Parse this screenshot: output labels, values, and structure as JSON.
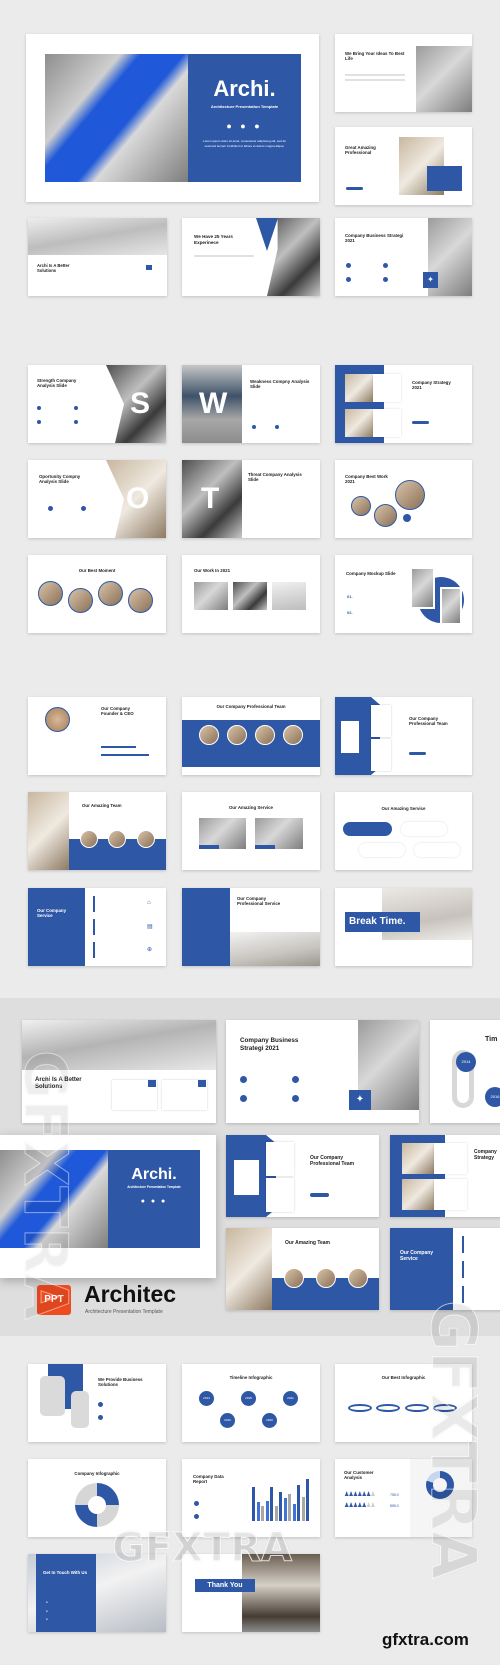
{
  "brand_color": "#2e58a6",
  "accent_color": "#ef4b21",
  "hero": {
    "title": "Archi.",
    "subtitle": "Architecture Presentation Template",
    "body": "Lorem ipsum dolor sit amet, consectetur adipiscing elit, sed do eiusmod tempor incididunt ut labore et dolore magna aliqua."
  },
  "slides_group1": [
    {
      "title": "We Bring Your Ideas To Best Life"
    },
    {
      "title": "Great Amazing Professional"
    },
    {
      "title": "Archi Is A Better Solutions"
    },
    {
      "title": "We Have 25 Years Experinece"
    },
    {
      "title": "Company Business Strategi 2021"
    }
  ],
  "slides_group2": [
    {
      "title": "Strength Company Analysis Slide",
      "letter": "S"
    },
    {
      "title": "Weakness Compny Analysis Slide",
      "letter": "W"
    },
    {
      "title": "Company Strategy 2021"
    },
    {
      "title": "Oportunity Compny Analysis Slide",
      "letter": "O"
    },
    {
      "title": "Threat Company Analysis Slide",
      "letter": "T"
    },
    {
      "title": "Company Best Work 2021"
    },
    {
      "title": "Our Best Moment"
    },
    {
      "title": "Our Work In 2021"
    },
    {
      "title": "Company Mockup Slide",
      "items": [
        "01.",
        "02."
      ]
    }
  ],
  "slides_group3": [
    {
      "title": "Our Company Founder & CEO"
    },
    {
      "title": "Our Company Professional Team"
    },
    {
      "title": "Our Company Professional Team"
    },
    {
      "title": "Our Amazing Team"
    },
    {
      "title": "Our Amazing Service"
    },
    {
      "title": "Our Amazing Service"
    },
    {
      "title": "Our Company Service"
    },
    {
      "title": "Our Company Professional Service"
    },
    {
      "title": "Break Time."
    }
  ],
  "showcase": {
    "s1": "Archi Is A Better Solutions",
    "s2": "Company Business Strategi 2021",
    "s3": "Tim",
    "timeline_years": [
      "2014",
      "2016"
    ],
    "hero_title": "Archi.",
    "hero_subtitle": "Architecture Presentation Template",
    "s4": "Our Company Professional Team",
    "s5": "Company Strategy",
    "s6": "Our Amazing Team",
    "s7": "Our Company Service"
  },
  "product": {
    "badge": "PPT",
    "name": "Architec",
    "tagline": "Architecture Presentation Template"
  },
  "slides_group4": [
    {
      "title": "We Provide Business Solutions"
    },
    {
      "title": "Timeline Infographic",
      "years": [
        "2014",
        "2016",
        "2018",
        "2020",
        "2021"
      ]
    },
    {
      "title": "Our Best Infographic"
    },
    {
      "title": "Company Infographic"
    },
    {
      "title": "Company Data Report",
      "bars": [
        0.8,
        0.45,
        0.35,
        0.48,
        0.8,
        0.35,
        0.7,
        0.55,
        0.65,
        0.4,
        0.85,
        0.58,
        1.0
      ]
    },
    {
      "title": "Our Customer Analysis",
      "values": [
        "755.0",
        "855.0"
      ],
      "donut_fill": 0.8
    },
    {
      "title": "Get In Touch With Us"
    },
    {
      "title": "Thank You"
    }
  ],
  "watermark": {
    "vertical": "GFXTRA",
    "horizontal": "GFXTRA",
    "site": "gfxtra.com"
  }
}
